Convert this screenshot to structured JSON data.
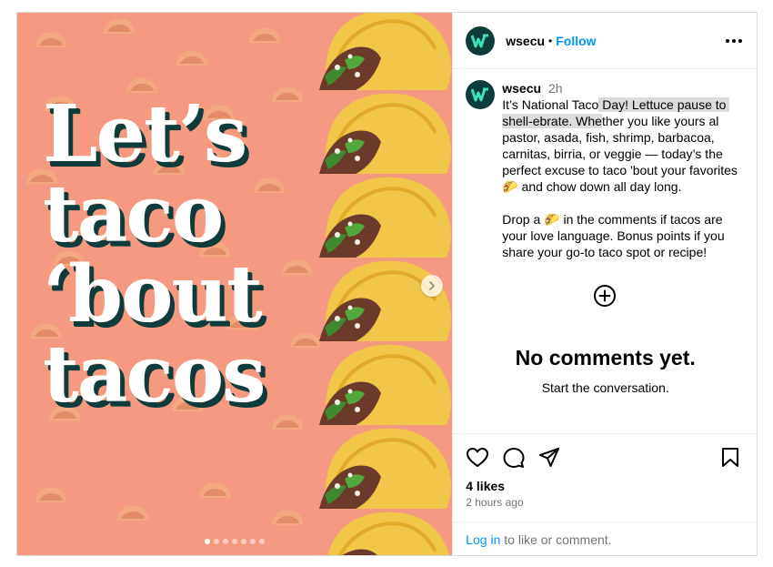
{
  "post": {
    "headline_lines": [
      "Let’s",
      "taco",
      "‘bout",
      "tacos"
    ],
    "carousel": {
      "slide_count": 7,
      "active_index": 0
    },
    "colors": {
      "background": "#f59a80",
      "text_shadow": "#0f3b3b",
      "follow": "#0095f6"
    }
  },
  "header": {
    "username": "wsecu",
    "separator": "•",
    "follow_label": "Follow",
    "more_icon": "more-horizontal-icon"
  },
  "caption": {
    "username": "wsecu",
    "time": "2h",
    "text_before": "It’s National Taco",
    "text_highlight": " Day! Lettuce pause to shell-ebrate. Whe",
    "text_after": "ther you like yours al pastor, asada, fish, shrimp, barbacoa, carnitas, birria, or veggie — today’s the perfect excuse to taco 'bout your favorites 🌮 and chow down all day long.\n\nDrop a 🌮 in the comments if tacos are your love language. Bonus points if you share your go-to taco spot or recipe!"
  },
  "comments": {
    "add_icon": "plus-circle-icon",
    "empty_title": "No comments yet.",
    "empty_subtitle": "Start the conversation."
  },
  "actions": {
    "icons": [
      "heart-icon",
      "comment-icon",
      "share-icon",
      "bookmark-icon"
    ],
    "likes": "4 likes",
    "time_ago": "2 hours ago",
    "login_link": "Log in",
    "login_rest": " to like or comment."
  }
}
